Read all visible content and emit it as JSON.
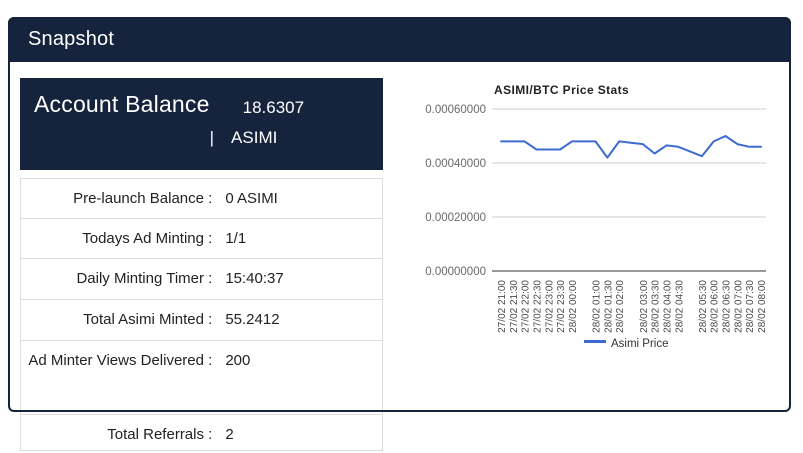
{
  "header": {
    "title": "Snapshot"
  },
  "colors": {
    "navy": "#16233d",
    "line_blue": "#3c6cd1",
    "row_border": "#dddddd",
    "grid_line": "#cccccc",
    "axis_baseline": "#333333"
  },
  "balance_card": {
    "title": "Account Balance",
    "value": "18.6307",
    "unit_separator": "|",
    "unit": "ASIMI",
    "rows": [
      {
        "label": "Pre-launch Balance :",
        "value": "0 ASIMI"
      },
      {
        "label": "Todays Ad Minting :",
        "value": "1/1"
      },
      {
        "label": "Daily Minting Timer :",
        "value": "15:40:37"
      },
      {
        "label": "Total Asimi Minted :",
        "value": "55.2412"
      },
      {
        "label": "Ad Minter Views Delivered :",
        "value": "200"
      },
      {
        "label": "Total Referrals :",
        "value": "2"
      }
    ]
  },
  "chart_data": {
    "type": "line",
    "title": "ASIMI/BTC Price Stats",
    "x": [
      "27/02 21:00",
      "27/02 21:30",
      "27/02 22:00",
      "27/02 22:30",
      "27/02 23:00",
      "27/02 23:30",
      "28/02 00:00",
      "28/02 01:00",
      "28/02 01:30",
      "28/02 02:00",
      "28/02 03:00",
      "28/02 03:30",
      "28/02 04:00",
      "28/02 04:30",
      "28/02 05:30",
      "28/02 06:00",
      "28/02 06:30",
      "28/02 07:00",
      "28/02 07:30",
      "28/02 08:00"
    ],
    "series": [
      {
        "name": "Asimi Price",
        "color": "#3c6cd1",
        "values": [
          0.00048,
          0.00048,
          0.00048,
          0.00045,
          0.00045,
          0.00045,
          0.00048,
          0.00048,
          0.00042,
          0.00048,
          0.00047,
          0.000435,
          0.000465,
          0.00046,
          0.000425,
          0.00048,
          0.0005,
          0.00047,
          0.00046,
          0.00046
        ]
      }
    ],
    "xlabel": "",
    "ylabel": "",
    "ylim": [
      0,
      0.0006
    ],
    "yticks": [
      "0.00060000",
      "0.00040000",
      "0.00020000",
      "0.00000000"
    ],
    "grid": true,
    "time_axis": true,
    "legend_position": "bottom"
  }
}
